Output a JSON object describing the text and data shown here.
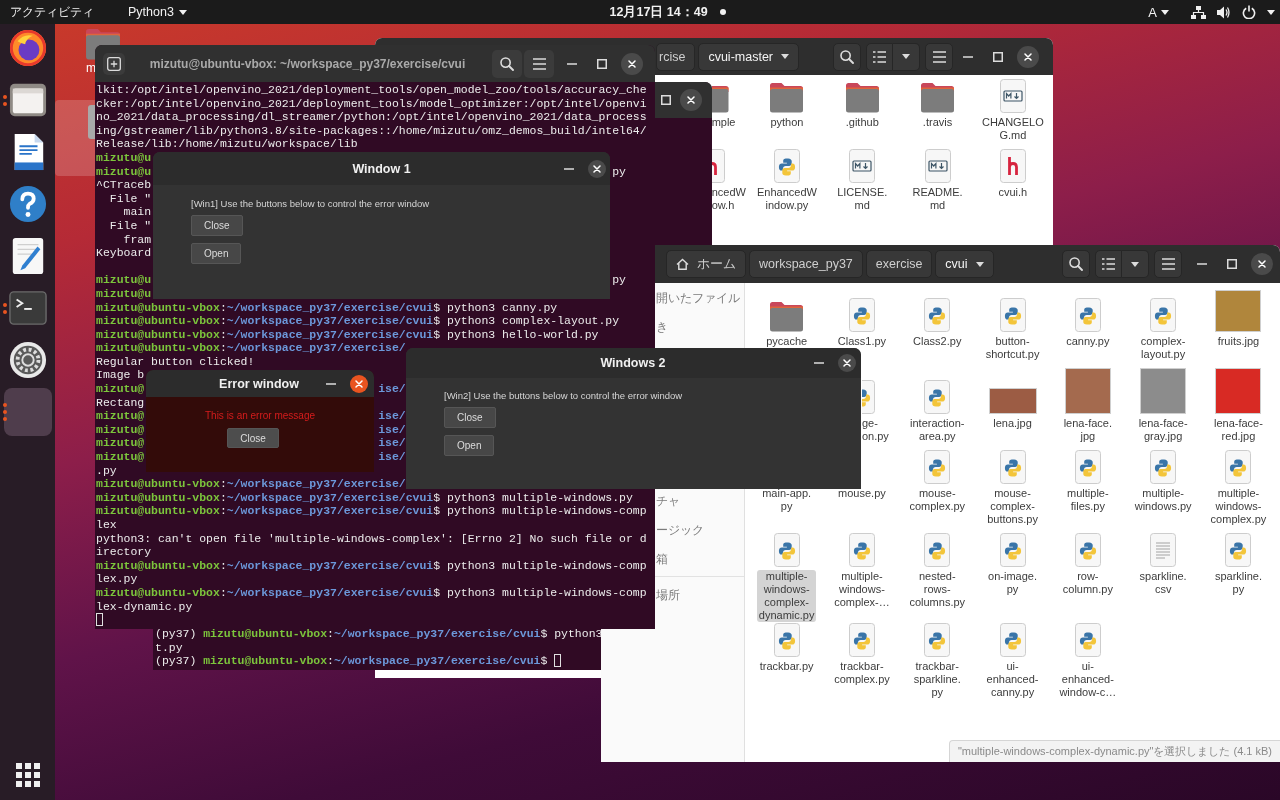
{
  "top_bar": {
    "activities": "アクティビティ",
    "app_menu": "Python3",
    "clock": "12月17日 14：49",
    "notification": true,
    "keyboard_layout": "A"
  },
  "dock": [
    {
      "kind": "firefox",
      "selected": false
    },
    {
      "kind": "files",
      "selected": false,
      "running_windows": [
        {
          "kind": "dot"
        },
        {
          "kind": "dot"
        }
      ]
    },
    {
      "kind": "writer",
      "selected": false
    },
    {
      "kind": "help",
      "selected": false
    },
    {
      "kind": "text-editor",
      "selected": false
    },
    {
      "kind": "terminal",
      "selected": false,
      "running_windows": [
        {
          "kind": "dot"
        },
        {
          "kind": "dot"
        }
      ]
    },
    {
      "kind": "settings",
      "selected": false
    },
    {
      "kind": "app",
      "selected": true,
      "running_windows": [
        {
          "kind": "dot"
        },
        {
          "kind": "dot"
        },
        {
          "kind": "dot"
        }
      ]
    }
  ],
  "desktop_icons": [
    {
      "kind": "folder",
      "label": "m",
      "selected": false
    },
    {
      "kind": "item",
      "selected": true
    }
  ],
  "back_file_manager": {
    "focused": false,
    "path": [
      {
        "kind": "folder",
        "label": "rcise",
        "selected": false
      },
      {
        "kind": "folder",
        "label": "cvui-master",
        "selected": true
      }
    ],
    "items": [
      {
        "kind": "folder",
        "label": "mple",
        "selected": false
      },
      {
        "kind": "folder",
        "label": "python",
        "selected": false
      },
      {
        "kind": "folder",
        "label": ".github",
        "selected": false
      },
      {
        "kind": "folder",
        "label": ".travis",
        "selected": false
      },
      {
        "kind": "markdown",
        "label": "CHANGELO\nG.md",
        "selected": false
      },
      {
        "kind": "header",
        "label": "ncedW\now.h",
        "selected": false
      },
      {
        "kind": "python",
        "label": "EnhancedW\nindow.py",
        "selected": false
      },
      {
        "kind": "markdown",
        "label": "LICENSE.\nmd",
        "selected": false
      },
      {
        "kind": "markdown",
        "label": "README.\nmd",
        "selected": false
      },
      {
        "kind": "header",
        "label": "cvui.h",
        "selected": false
      }
    ]
  },
  "back_terminal": {
    "focused": false,
    "lines": [
      {
        "env": "(py37) ",
        "user": "mizutu@ubuntu-vbox",
        "colon": ":",
        "path": "~/workspace_py37/exercise/cvui",
        "rest": "$ python3"
      },
      {
        "rest": "t.py"
      },
      {
        "env": "(py37) ",
        "user": "mizutu@ubuntu-vbox",
        "colon": ":",
        "path": "~/workspace_py37/exercise/cvui",
        "rest": "$ ",
        "cursor": true
      }
    ]
  },
  "front_file_manager": {
    "focused": false,
    "path": [
      {
        "kind": "home",
        "label": "ホーム",
        "selected": false
      },
      {
        "kind": "folder",
        "label": "workspace_py37",
        "selected": false
      },
      {
        "kind": "folder",
        "label": "exercise",
        "selected": false
      },
      {
        "kind": "folder",
        "label": "cvui",
        "selected": true
      }
    ],
    "sidebar": [
      {
        "label": "開いたファイル",
        "selected": false
      },
      {
        "label": "き",
        "selected": false
      },
      {
        "label": "チャ",
        "selected": false
      },
      {
        "label": "ージック",
        "selected": false
      },
      {
        "label": "箱",
        "selected": false
      },
      {
        "label": "場所",
        "selected": false
      }
    ],
    "items": [
      {
        "kind": "folder",
        "label": "pycache",
        "selected": false
      },
      {
        "kind": "python",
        "label": "Class1.py",
        "selected": false
      },
      {
        "kind": "python",
        "label": "Class2.py",
        "selected": false
      },
      {
        "kind": "python",
        "label": "button-\nshortcut.py",
        "selected": false
      },
      {
        "kind": "python",
        "label": "canny.py",
        "selected": false
      },
      {
        "kind": "python",
        "label": "complex-\nlayout.py",
        "selected": false
      },
      {
        "kind": "photo-square",
        "label": "fruits.jpg",
        "color": "#b0863c",
        "selected": false
      },
      {
        "kind": "python",
        "label": "ge-\non.py",
        "selected": false
      },
      {
        "kind": "python",
        "label": "interaction-\narea.py",
        "selected": false
      },
      {
        "kind": "photo-landscape",
        "label": "lena.jpg",
        "color": "#9c5c44",
        "selected": false
      },
      {
        "kind": "photo-portrait",
        "label": "lena-face.\njpg",
        "color": "#a46a4e",
        "selected": false
      },
      {
        "kind": "photo-portrait",
        "label": "lena-face-\ngray.jpg",
        "color": "#8c8c8c",
        "selected": false
      },
      {
        "kind": "photo-portrait",
        "label": "lena-face-\nred.jpg",
        "color": "#d82a24",
        "selected": false
      },
      {
        "label": "main-app.\npy",
        "selected": false
      },
      {
        "label": "mouse.py",
        "selected": false
      },
      {
        "kind": "python",
        "label": "mouse-\ncomplex.py",
        "selected": false
      },
      {
        "kind": "python",
        "label": "mouse-\ncomplex-\nbuttons.py",
        "selected": false
      },
      {
        "kind": "python",
        "label": "multiple-\nfiles.py",
        "selected": false
      },
      {
        "kind": "python",
        "label": "multiple-\nwindows.py",
        "selected": false
      },
      {
        "kind": "python",
        "label": "multiple-\nwindows-\ncomplex.py",
        "selected": false
      },
      {
        "kind": "python",
        "label": "multiple-\nwindows-\ncomplex-\ndynamic.py",
        "selected": true
      },
      {
        "kind": "python",
        "label": "multiple-\nwindows-\ncomplex-…",
        "selected": false
      },
      {
        "kind": "python",
        "label": "nested-\nrows-\ncolumns.py",
        "selected": false
      },
      {
        "kind": "python",
        "label": "on-image.\npy",
        "selected": false
      },
      {
        "kind": "python",
        "label": "row-\ncolumn.py",
        "selected": false
      },
      {
        "kind": "text",
        "label": "sparkline.\ncsv",
        "selected": false
      },
      {
        "kind": "python",
        "label": "sparkline.\npy",
        "selected": false
      },
      {
        "kind": "python",
        "label": "trackbar.py",
        "selected": false
      },
      {
        "kind": "python",
        "label": "trackbar-\ncomplex.py",
        "selected": false
      },
      {
        "kind": "python",
        "label": "trackbar-\nsparkline.\npy",
        "selected": false
      },
      {
        "kind": "python",
        "label": "ui-\nenhanced-\ncanny.py",
        "selected": false
      },
      {
        "kind": "python",
        "label": "ui-\nenhanced-\nwindow-c…",
        "selected": false
      }
    ],
    "status": "\"multiple-windows-complex-dynamic.py\"を選択しました (4.1 kB)"
  },
  "terminal": {
    "title": "mizutu@ubuntu-vbox: ~/workspace_py37/exercise/cvui",
    "focused": false,
    "lines": [
      {
        "rest": "lkit:/opt/intel/openvino_2021/deployment_tools/open_model_zoo/tools/accuracy_che"
      },
      {
        "rest": "cker:/opt/intel/openvino_2021/deployment_tools/model_optimizer:/opt/intel/openvi"
      },
      {
        "rest": "no_2021/data_processing/dl_streamer/python:/opt/intel/openvino_2021/data_process"
      },
      {
        "rest": "ing/gstreamer/lib/python3.8/site-packages::/home/mizutu/omz_demos_build/intel64/"
      },
      {
        "rest": "Release/lib:/home/mizutu/workspace/lib"
      },
      {
        "user": "mizutu@u"
      },
      {
        "user": "mizutu@u",
        "tail": "py"
      },
      {
        "rest": "^CTraceb"
      },
      {
        "rest": "  File \""
      },
      {
        "rest": "    main"
      },
      {
        "rest": "  File \""
      },
      {
        "rest": "    fram"
      },
      {
        "rest": "Keyboard"
      },
      {
        "user": "mizutu@u",
        "tail": "py"
      },
      {
        "user": "mizutu@u"
      },
      {
        "user": "mizutu@ubuntu-vbox",
        "colon": ":",
        "path": "~/workspace_py37/exercise/cvui",
        "rest": "$ python3 canny.py"
      },
      {
        "user": "mizutu@ubuntu-vbox",
        "colon": ":",
        "path": "~/workspace_py37/exercise/cvui",
        "rest": "$ python3 complex-layout.py"
      },
      {
        "user": "mizutu@ubuntu-vbox",
        "colon": ":",
        "path": "~/workspace_py37/exercise/cvui",
        "rest": "$ python3 hello-world.py"
      },
      {
        "user": "mizutu@ubuntu-vbox",
        "colon": ":",
        "path": "~/workspace_py37/exercise/"
      },
      {
        "rest": "Regular button clicked!"
      },
      {
        "rest": "Image b"
      },
      {
        "user": "mizutu@",
        "tail_path": "ise/"
      },
      {
        "rest": "Rectang"
      },
      {
        "user": "mizutu@",
        "tail_path": "ise/"
      },
      {
        "user": "mizutu@",
        "tail_path": "ise/"
      },
      {
        "user": "mizutu@",
        "tail_path": "ise/"
      },
      {
        "user": "mizutu@",
        "tail_path": "ise/"
      },
      {
        "rest": ".py"
      },
      {
        "user": "mizutu@ubuntu-vbox",
        "colon": ":",
        "path": "~/workspace_py37/exercise/"
      },
      {
        "user": "mizutu@ubuntu-vbox",
        "colon": ":",
        "path": "~/workspace_py37/exercise/cvui",
        "rest": "$ python3 multiple-windows.py"
      },
      {
        "user": "mizutu@ubuntu-vbox",
        "colon": ":",
        "path": "~/workspace_py37/exercise/cvui",
        "rest": "$ python3 multiple-windows-comp"
      },
      {
        "rest": "lex"
      },
      {
        "rest": "python3: can't open file 'multiple-windows-complex': [Errno 2] No such file or d"
      },
      {
        "rest": "irectory"
      },
      {
        "user": "mizutu@ubuntu-vbox",
        "colon": ":",
        "path": "~/workspace_py37/exercise/cvui",
        "rest": "$ python3 multiple-windows-comp"
      },
      {
        "rest": "lex.py"
      },
      {
        "user": "mizutu@ubuntu-vbox",
        "colon": ":",
        "path": "~/workspace_py37/exercise/cvui",
        "rest": "$ python3 multiple-windows-comp"
      },
      {
        "rest": "lex-dynamic.py"
      },
      {
        "cursor": true
      }
    ]
  },
  "window_1": {
    "title": "Window 1",
    "focused": false,
    "message": "[Win1] Use the buttons below to control the error window",
    "buttons": [
      "Close",
      "Open"
    ]
  },
  "error_window": {
    "title": "Error window",
    "focused": true,
    "message": "This is an error message",
    "buttons": [
      "Close"
    ]
  },
  "window_2": {
    "title": "Windows 2",
    "focused": false,
    "message": "[Win2] Use the buttons below to control the error window",
    "buttons": [
      "Close",
      "Open"
    ]
  }
}
